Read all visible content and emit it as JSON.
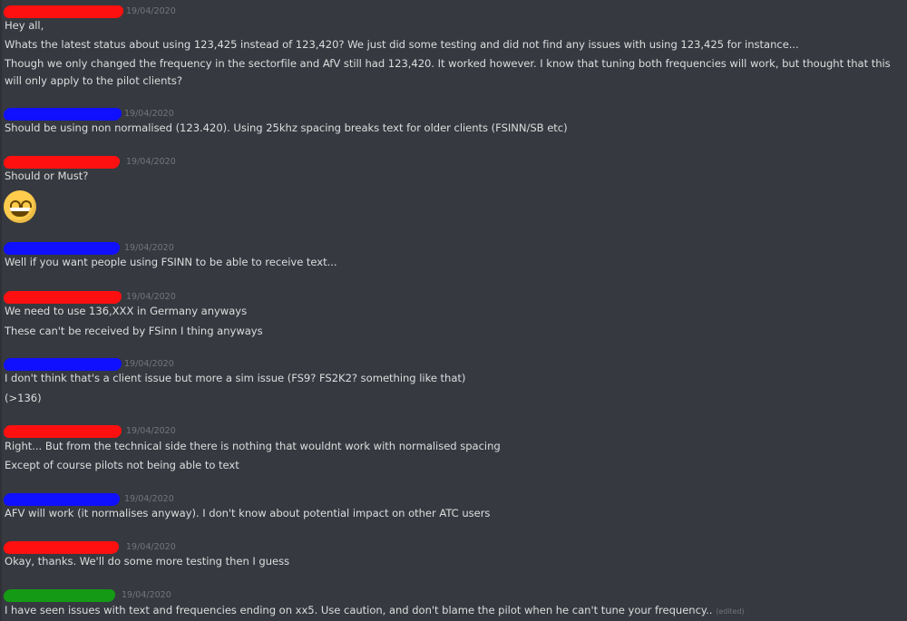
{
  "colors": {
    "red": "#ff1010",
    "blue": "#1010ff",
    "green": "#159a15",
    "background": "#36393f",
    "timestamp": "#72767d",
    "text": "#dcddde"
  },
  "messages": [
    {
      "redaction": "red",
      "timestamp": "19/04/2020",
      "lines": [
        "Hey all,",
        "Whats the latest status about using 123,425 instead of 123,420? We just did some testing and did not find any issues with using 123,425 for instance...",
        "Though we only changed the frequency in the sectorfile and AfV still had 123,420. It worked however. I know that tuning both frequencies will work, but thought that this will only apply to the pilot clients?"
      ]
    },
    {
      "redaction": "blue",
      "timestamp": "19/04/2020",
      "lines": [
        "Should be using non normalised (123.420). Using 25khz spacing breaks text for older clients (FSINN/SB etc)"
      ]
    },
    {
      "redaction": "red",
      "timestamp": "19/04/2020",
      "lines": [
        "Should or Must?"
      ],
      "emoji": "grinning-face-with-smiling-eyes"
    },
    {
      "redaction": "blue",
      "timestamp": "19/04/2020",
      "lines": [
        "Well if you want people using FSINN to be able to receive text..."
      ]
    },
    {
      "redaction": "red",
      "timestamp": "19/04/2020",
      "lines": [
        "We need to use 136,XXX in Germany anyways",
        "These can't be received by FSinn I thing anyways"
      ]
    },
    {
      "redaction": "blue",
      "timestamp": "19/04/2020",
      "lines": [
        "I don't think that's a client issue but more a sim issue (FS9? FS2K2? something like that)",
        "(>136)"
      ]
    },
    {
      "redaction": "red",
      "timestamp": "19/04/2020",
      "lines": [
        "Right... But from the technical side there is nothing that wouldnt work with normalised spacing",
        "Except of course pilots not being able to text"
      ]
    },
    {
      "redaction": "blue",
      "timestamp": "19/04/2020",
      "lines": [
        "AFV will work (it normalises anyway). I don't know about potential impact on other ATC users"
      ]
    },
    {
      "redaction": "red",
      "timestamp": "19/04/2020",
      "lines": [
        "Okay, thanks. We'll do some more testing then I guess"
      ]
    },
    {
      "redaction": "green",
      "timestamp": "19/04/2020",
      "lines": [
        "I have seen issues with text and frequencies ending on xx5. Use caution, and don't blame the pilot when he can't tune your frequency.."
      ],
      "edited": "(edited)"
    }
  ]
}
